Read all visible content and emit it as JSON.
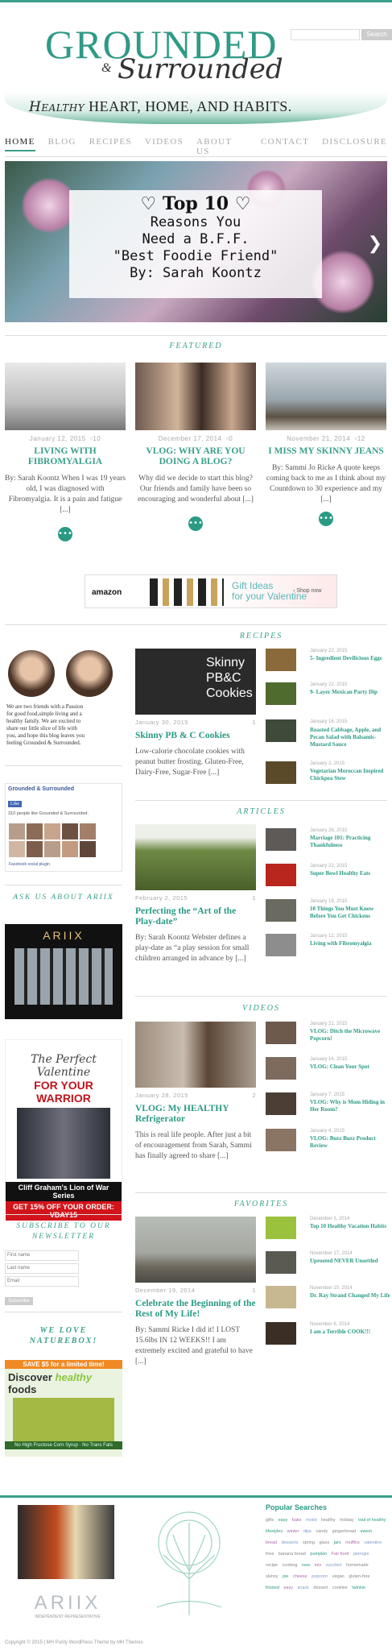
{
  "header": {
    "logo_main": "GROUNDED",
    "logo_amp": "&",
    "logo_script": "Surrounded",
    "tagline_script": "Healthy",
    "tagline_rest": "HEART, HOME, AND HABITS.",
    "search_placeholder": "",
    "search_button": "Search"
  },
  "nav": [
    "HOME",
    "BLOG",
    "RECIPES",
    "VIDEOS",
    "ABOUT US",
    "CONTACT",
    "DISCLOSURE"
  ],
  "slider": {
    "line1": "♡ Top 10 ♡",
    "line2": "Reasons You",
    "line3": "Need a B.F.F.",
    "line4": "\"Best Foodie Friend\"",
    "line5": "By: Sarah Koontz",
    "next_arrow": "❯"
  },
  "featured": {
    "title": "FEATURED",
    "posts": [
      {
        "date": "January 12, 2015",
        "comments": "10",
        "title": "LIVING WITH FIBROMYALGIA",
        "excerpt": "By: Sarah Koontz When I was 19 years old, I was diagnosed with Fibromyalgia. It is a pain and fatigue [...]",
        "more": "•••"
      },
      {
        "date": "December 17, 2014",
        "comments": "0",
        "title": "VLOG: WHY ARE YOU DOING A BLOG?",
        "excerpt": "Why did we decide to start this blog? Our friends and family have been so encouraging and wonderful about [...]",
        "more": "•••"
      },
      {
        "date": "November 21, 2014",
        "comments": "12",
        "title": "I MISS MY SKINNY JEANS",
        "excerpt": "By: Sammi Jo Ricke A quote keeps coming back to me as I think about my Countdown to 30 experience and my [...]",
        "more": "•••"
      }
    ]
  },
  "ad": {
    "brand": "amazon",
    "line1": "Gift Ideas",
    "line2": "for your Valentine",
    "shop": "› Shop now"
  },
  "sidebar": {
    "intro_text": "We are two friends with a Passion for good food,simple living and a healthy family. We are excited to share our little slice of life with you, and hope this blog leaves you feeling Grounded & Surrounded.",
    "fb_title": "Grounded & Surrounded",
    "fb_like": "Like",
    "fb_count": "310 people like Grounded & Surrounded.",
    "fb_plugin": "Facebook social plugin",
    "ask_title": "ASK US ABOUT ARIIX",
    "ariix_logo": "ARIIX",
    "val_title1": "The Perfect Valentine",
    "val_title2": "FOR YOUR WARRIOR",
    "val_series": "Cliff Graham's Lion of War Series",
    "val_code": "GET 15% OFF YOUR ORDER: VDAY15",
    "newsletter_title": "SUBSCRIBE TO OUR NEWSLETTER",
    "first_name": "First name",
    "last_name": "Last name",
    "email": "Email",
    "subscribe": "Subscribe",
    "naturebox_title": "WE LOVE NATUREBOX!",
    "nb_bar": "SAVE $5 for a limited time!",
    "nb_disc1": "Discover",
    "nb_disc2": "healthy",
    "nb_disc3": "foods",
    "nb_foot": "No High Fructose Corn Syrup · No Trans Fats"
  },
  "recipes": {
    "title": "RECIPES",
    "main": {
      "date": "January 30, 2015",
      "comments": "1",
      "title": "Skinny PB & C Cookies",
      "excerpt": "Low-calorie chocolate cookies with peanut butter frosting. Gluten-Free, Dairy-Free, Sugar-Free [...]",
      "img_text": "Skinny PB&C Cookies"
    },
    "list": [
      {
        "date": "January 22, 2015",
        "title": "5- Ingredient Devilicious Eggs"
      },
      {
        "date": "January 22, 2015",
        "title": "9- Layer Mexican Party Dip"
      },
      {
        "date": "January 16, 2015",
        "title": "Roasted Cabbage, Apple, and Pecan Salad with Balsamic-Mustard Sauce"
      },
      {
        "date": "January 2, 2015",
        "title": "Vegetarian Moroccan Inspired Chickpea Stew"
      }
    ]
  },
  "articles": {
    "title": "ARTICLES",
    "main": {
      "date": "February 2, 2015",
      "comments": "1",
      "title": "Perfecting the “Art of the Play-date”",
      "excerpt": "By: Sarah Koontz Webster defines a play-date as “a play session for small children arranged in advance by [...]"
    },
    "list": [
      {
        "date": "January 26, 2015",
        "title": "Marriage 101: Practicing Thankfulness"
      },
      {
        "date": "January 22, 2015",
        "title": "Super Bowl Healthy Eats"
      },
      {
        "date": "January 19, 2015",
        "title": "10 Things You Must Know Before You Get Chickens"
      },
      {
        "date": "January 12, 2015",
        "title": "Living with Fibromyalgia"
      }
    ]
  },
  "videos": {
    "title": "VIDEOS",
    "main": {
      "date": "January 28, 2015",
      "comments": "2",
      "title": "VLOG: My HEALTHY Refrigerator",
      "excerpt": "This is real life people. After just a bit of encouragement from Sarah, Sammi has finally agreed to share [...]"
    },
    "list": [
      {
        "date": "January 21, 2015",
        "title": "VLOG: Ditch the Microwave Popcorn!"
      },
      {
        "date": "January 14, 2015",
        "title": "VLOG: Clean Your Spot"
      },
      {
        "date": "January 7, 2015",
        "title": "VLOG: Why is Mom Hiding in Her Room?"
      },
      {
        "date": "January 4, 2015",
        "title": "VLOG: Buzz Buzz Product Review"
      }
    ]
  },
  "favorites": {
    "title": "FAVORITES",
    "main": {
      "date": "December 19, 2014",
      "comments": "1",
      "title": "Celebrate the Beginning of the Rest of My Life!",
      "excerpt": "By: Sammi Ricke I did it! I LOST 15.6lbs IN 12 WEEKS!! I am extremely excited and grateful to have [...]"
    },
    "list": [
      {
        "date": "December 3, 2014",
        "title": "Top 10 Healthy Vacation Habits"
      },
      {
        "date": "November 17, 2014",
        "title": "Uprooted NEVER Unsettled"
      },
      {
        "date": "November 10, 2014",
        "title": "Dr. Ray Strand Changed My Life"
      },
      {
        "date": "November 6, 2014",
        "title": "I am a Terrible COOK!!!"
      }
    ]
  },
  "footer": {
    "popular_title": "Popular Searches",
    "tags": [
      "gifts",
      "easy",
      "bake",
      "moist",
      "healthy",
      "holiday",
      "trail of healthy lifestyles",
      "winter",
      "dips",
      "candy",
      "gingerbread",
      "sweet",
      "bread",
      "desserts",
      "spring",
      "glass",
      "jars",
      "muffins",
      "valentine",
      "fries",
      "banana bread",
      "pumpkin",
      "Fair food",
      "pierogie",
      "recipe",
      "cooking",
      "new",
      "mix",
      "zucchini",
      "homemade",
      "skinny",
      "pie",
      "cheese",
      "popcorn",
      "vegan",
      "gluten-free",
      "frosted",
      "easy",
      "snack",
      "dessert",
      "cookies",
      "twinkie"
    ],
    "ariix_logo": "ARIIX",
    "ariix_sub": "INDEPENDENT REPRESENTATIVE",
    "copyright": "Copyright © 2015 | MH Purity WordPress Theme by MH Themes"
  },
  "colors": {
    "accent": "#3aa08a",
    "accent_dark": "#2a9a84"
  }
}
